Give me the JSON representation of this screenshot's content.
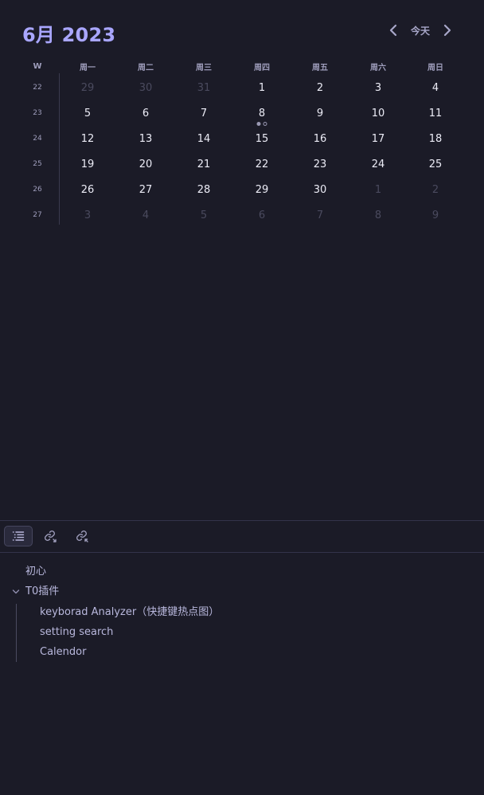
{
  "calendar": {
    "title": "6月 2023",
    "today_label": "今天",
    "week_header": "W",
    "weekdays": [
      "周一",
      "周二",
      "周三",
      "周四",
      "周五",
      "周六",
      "周日"
    ],
    "weeks": [
      {
        "week": "22",
        "days": [
          {
            "d": "29",
            "faded": true
          },
          {
            "d": "30",
            "faded": true
          },
          {
            "d": "31",
            "faded": true
          },
          {
            "d": "1"
          },
          {
            "d": "2"
          },
          {
            "d": "3"
          },
          {
            "d": "4"
          }
        ]
      },
      {
        "week": "23",
        "days": [
          {
            "d": "5"
          },
          {
            "d": "6"
          },
          {
            "d": "7"
          },
          {
            "d": "8",
            "dots": [
              "filled",
              "hollow"
            ]
          },
          {
            "d": "9"
          },
          {
            "d": "10"
          },
          {
            "d": "11"
          }
        ]
      },
      {
        "week": "24",
        "days": [
          {
            "d": "12"
          },
          {
            "d": "13"
          },
          {
            "d": "14"
          },
          {
            "d": "15"
          },
          {
            "d": "16"
          },
          {
            "d": "17"
          },
          {
            "d": "18"
          }
        ]
      },
      {
        "week": "25",
        "days": [
          {
            "d": "19"
          },
          {
            "d": "20"
          },
          {
            "d": "21"
          },
          {
            "d": "22"
          },
          {
            "d": "23"
          },
          {
            "d": "24"
          },
          {
            "d": "25"
          }
        ]
      },
      {
        "week": "26",
        "days": [
          {
            "d": "26"
          },
          {
            "d": "27"
          },
          {
            "d": "28"
          },
          {
            "d": "29"
          },
          {
            "d": "30"
          },
          {
            "d": "1",
            "faded": true
          },
          {
            "d": "2",
            "faded": true
          }
        ]
      },
      {
        "week": "27",
        "days": [
          {
            "d": "3",
            "faded": true
          },
          {
            "d": "4",
            "faded": true
          },
          {
            "d": "5",
            "faded": true
          },
          {
            "d": "6",
            "faded": true
          },
          {
            "d": "7",
            "faded": true
          },
          {
            "d": "8",
            "faded": true
          },
          {
            "d": "9",
            "faded": true
          }
        ]
      }
    ]
  },
  "tabs": [
    {
      "icon": "list-icon",
      "active": true
    },
    {
      "icon": "outgoing-link-icon",
      "active": false
    },
    {
      "icon": "backlink-icon",
      "active": false
    }
  ],
  "outline": {
    "items": [
      {
        "label": "初心"
      },
      {
        "label": "T0插件",
        "expanded": true
      },
      {
        "label": "keyborad Analyzer（快捷键热点图）"
      },
      {
        "label": "setting search"
      },
      {
        "label": "Calendor"
      }
    ]
  },
  "colors": {
    "background": "#1b1b27",
    "accent": "#a9a6ff",
    "text": "#ececf6",
    "muted": "#4a4a5e"
  }
}
